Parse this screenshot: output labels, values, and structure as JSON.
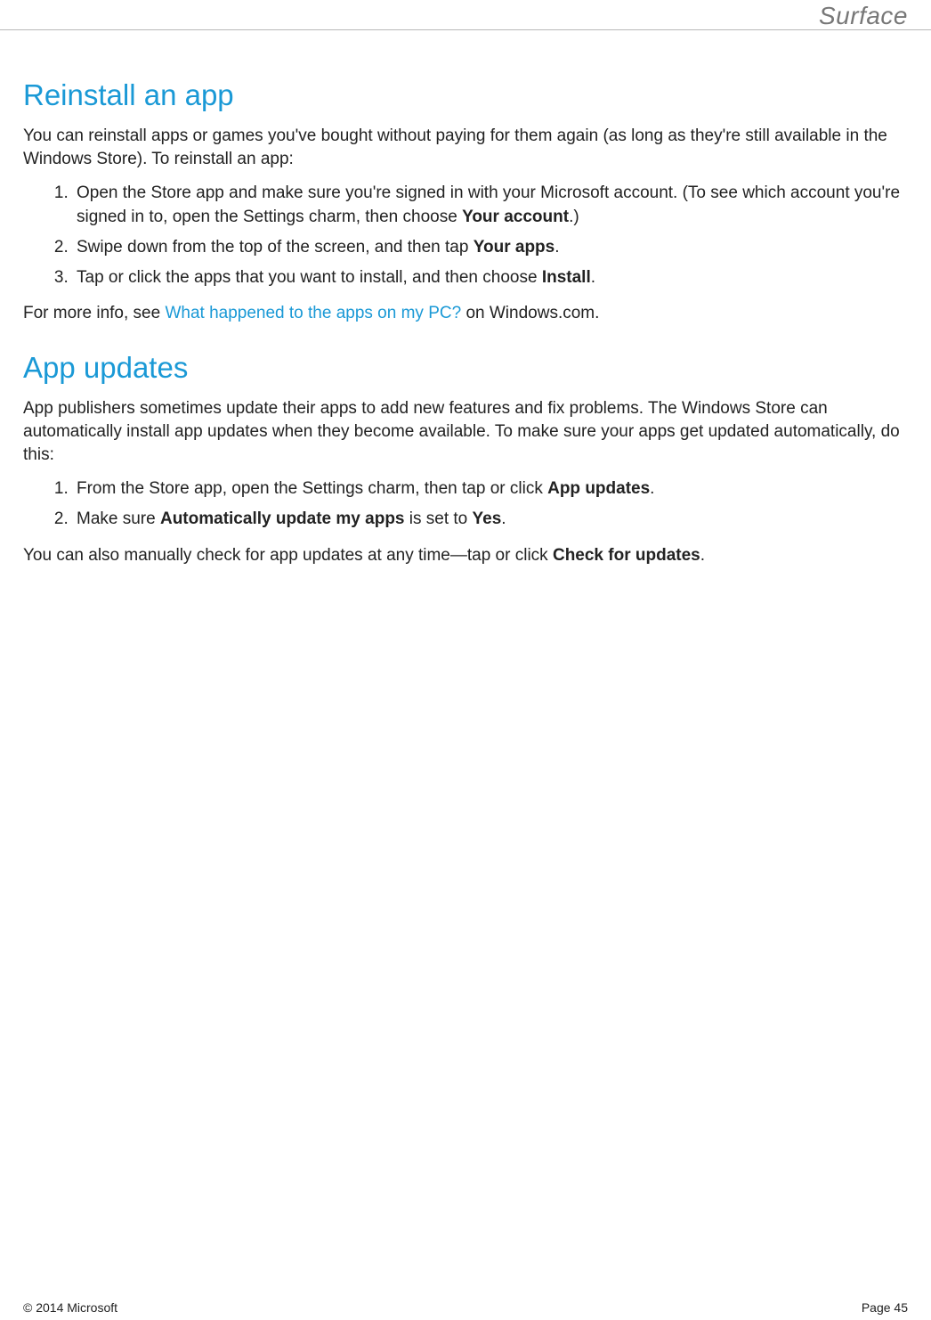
{
  "header": {
    "brand": "Surface"
  },
  "section1": {
    "heading": "Reinstall an app",
    "intro": "You can reinstall apps or games you've bought without paying for them again (as long as they're still available in the Windows Store). To reinstall an app:",
    "step1_a": "Open the Store app and make sure you're signed in with your Microsoft account. (To see which account you're signed in to, open the Settings charm, then choose ",
    "step1_bold": "Your account",
    "step1_b": ".)",
    "step2_a": "Swipe down from the top of the screen, and then tap ",
    "step2_bold": "Your apps",
    "step2_b": ".",
    "step3_a": "Tap or click the apps that you want to install, and then choose ",
    "step3_bold": "Install",
    "step3_b": ".",
    "outro_a": "For more info, see ",
    "outro_link": "What happened to the apps on my PC?",
    "outro_b": " on Windows.com."
  },
  "section2": {
    "heading": "App updates",
    "intro": "App publishers sometimes update their apps to add new features and fix problems. The Windows Store can automatically install app updates when they become available. To make sure your apps get updated automatically, do this:",
    "step1_a": "From the Store app, open the Settings charm, then tap or click ",
    "step1_bold": "App updates",
    "step1_b": ".",
    "step2_a": "Make sure ",
    "step2_bold1": "Automatically update my apps",
    "step2_mid": " is set to ",
    "step2_bold2": "Yes",
    "step2_b": ".",
    "outro_a": "You can also manually check for app updates at any time—tap or click ",
    "outro_bold": "Check for updates",
    "outro_b": "."
  },
  "footer": {
    "copyright": "© 2014 Microsoft",
    "page": "Page 45"
  }
}
